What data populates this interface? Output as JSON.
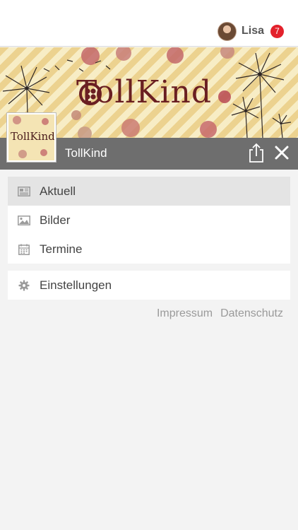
{
  "header": {
    "user_name": "Lisa",
    "notification_count": "7"
  },
  "cover": {
    "brand_text": "TollKind",
    "thumb_text": "TollKind"
  },
  "titlebar": {
    "title": "TollKind"
  },
  "menu": {
    "main_items": [
      {
        "label": "Aktuell",
        "icon": "newspaper-icon",
        "active": true
      },
      {
        "label": "Bilder",
        "icon": "image-icon",
        "active": false
      },
      {
        "label": "Termine",
        "icon": "calendar-icon",
        "active": false
      }
    ],
    "settings_label": "Einstellungen"
  },
  "footer_links": {
    "impressum": "Impressum",
    "datenschutz": "Datenschutz"
  },
  "colors": {
    "badge": "#e3212b",
    "titlebar": "#6e6e6e",
    "active_row": "#e4e4e4"
  }
}
